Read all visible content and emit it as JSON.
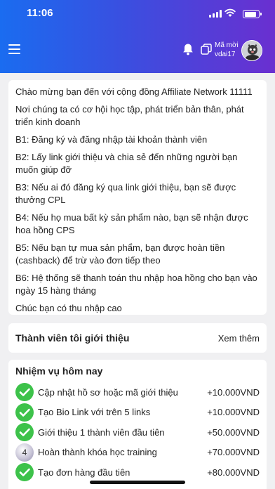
{
  "status_bar": {
    "time": "11:06"
  },
  "header": {
    "referral_label": "Mã mời",
    "referral_code": "vdai17"
  },
  "intro": {
    "paragraphs": [
      "Chào mừng bạn đến với cộng đồng Affiliate Network 11111",
      "Nơi chúng ta có cơ hội học tập, phát triển bản thân, phát triển kinh doanh",
      "B1: Đăng ký và đăng nhập tài khoản thành viên",
      "B2: Lấy link giới thiệu và chia sẻ đến những người bạn muốn giúp đỡ",
      "B3: Nếu ai đó đăng ký qua link giới thiệu, bạn sẽ được thưởng CPL",
      "B4: Nếu họ mua bất kỳ sản phẩm nào, bạn sẽ nhận được hoa hồng CPS",
      "B5: Nếu bạn tự mua sản phẩm, bạn được hoàn tiền (cashback) để trừ vào đơn tiếp theo",
      "B6: Hệ thống sẽ thanh toán thu nhập hoa hồng cho bạn vào ngày 15 hàng tháng",
      "Chúc bạn có thu nhập cao"
    ]
  },
  "invited": {
    "title": "Thành viên tôi giới thiệu",
    "see_more": "Xem thêm"
  },
  "tasks": {
    "title": "Nhiệm vụ hôm nay",
    "items": [
      {
        "label": "Cập nhật hồ sơ hoặc mã giới thiệu",
        "reward": "+10.000VND",
        "done": true
      },
      {
        "label": "Tạo Bio Link với trên 5 links",
        "reward": "+10.000VND",
        "done": true
      },
      {
        "label": "Giới thiệu 1 thành viên đầu tiên",
        "reward": "+50.000VND",
        "done": true
      },
      {
        "label": "Hoàn thành khóa học training",
        "reward": "+70.000VND",
        "done": false,
        "badge": "4"
      },
      {
        "label": "Tạo đơn hàng đầu tiên",
        "reward": "+80.000VND",
        "done": true
      }
    ]
  },
  "colors": {
    "header_start": "#1a6cf0",
    "header_end": "#6a2fd0",
    "done": "#3dc24a"
  }
}
